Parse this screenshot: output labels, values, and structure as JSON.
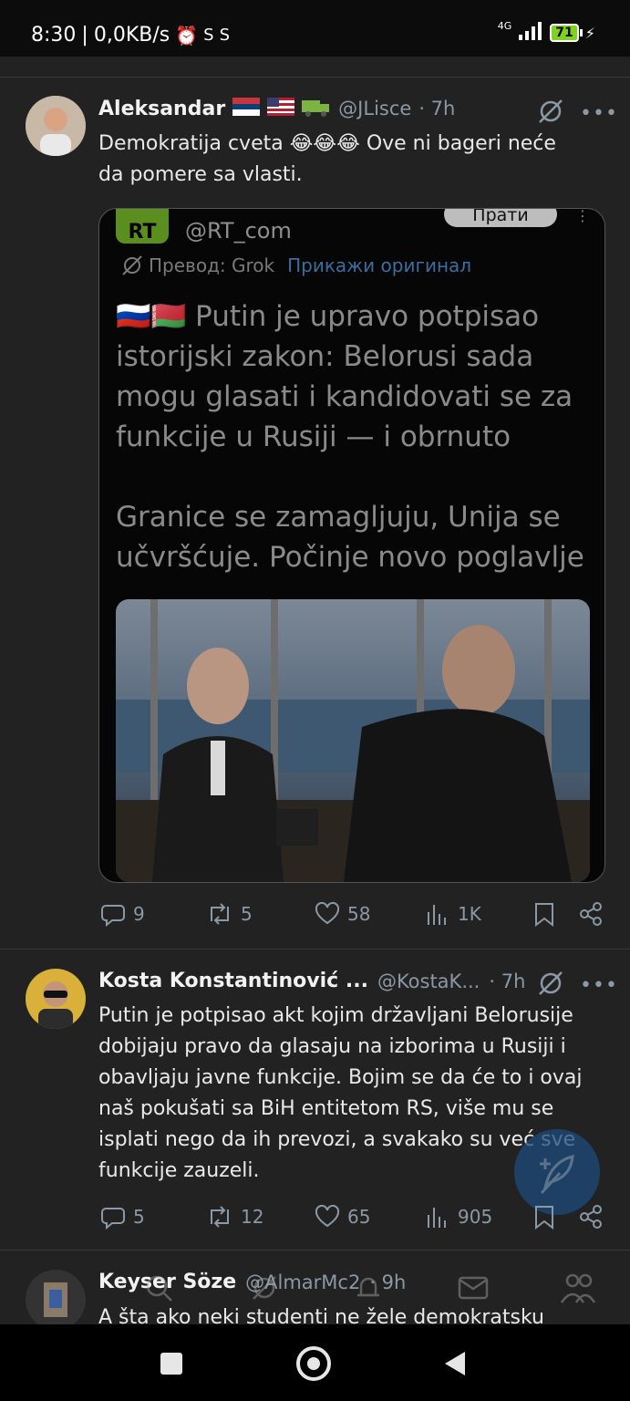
{
  "status": {
    "time": "8:30",
    "speed": "0,0KB/s",
    "network": "4G",
    "battery": "71"
  },
  "tweets": [
    {
      "name": "Aleksandar",
      "handle": "@JLisce",
      "time": "· 7h",
      "text_line1": "Demokratija cveta 😂😂😂 Ove ni bageri neće",
      "text_line2": "da pomere sa vlasti.",
      "quote": {
        "handle": "@RT_com",
        "follow_label": "Прати",
        "translation_label": "Превод: Grok",
        "show_original": "Прикажи оригинал",
        "line1": "🇷🇺🇧🇾 Putin je upravo potpisao",
        "line2": "istorijski zakon: Belorusi sada",
        "line3": "mogu glasati i kandidovati se za",
        "line4": "funkcije u Rusiji — i obrnuto",
        "line5": "Granice se zamagljuju, Unija se",
        "line6": "učvršćuje. Počinje novo poglavlje"
      },
      "replies": "9",
      "reposts": "5",
      "likes": "58",
      "views": "1K"
    },
    {
      "name": "Kosta Konstantinović ...",
      "handle": "@KostaK...",
      "time": "· 7h",
      "lines": [
        "Putin je potpisao akt kojim državljani Belorusije",
        "dobijaju pravo da glasaju na izborima u Rusiji i",
        "obavljaju javne funkcije. Bojim se da će to i ovaj",
        "naš pokušati sa BiH entitetom RS, više mu se",
        "isplati nego da ih prevozi, a svakako su već sve",
        "funkcije zauzeli."
      ],
      "replies": "5",
      "reposts": "12",
      "likes": "65",
      "views": "905"
    },
    {
      "name": "Keyser Söze",
      "handle": "@AlmarMc2",
      "time": "· 9h",
      "line1": "A šta ako neki studenti ne žele demokratsku"
    }
  ],
  "colors": {
    "background": "#222222",
    "accent": "#1d9bf0",
    "muted": "#8b98a5"
  }
}
